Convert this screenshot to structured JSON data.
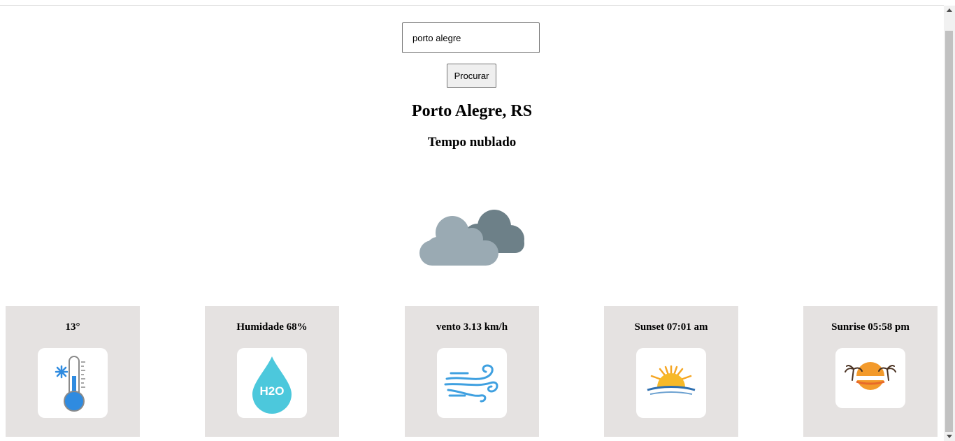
{
  "search": {
    "value": "porto alegre",
    "button_label": "Procurar"
  },
  "location": {
    "city": "Porto Alegre, RS"
  },
  "weather": {
    "condition": "Tempo nublado",
    "icon": "cloud-icon"
  },
  "cards": [
    {
      "label": "13°",
      "icon": "thermometer-icon"
    },
    {
      "label": "Humidade 68%",
      "icon": "water-drop-icon",
      "icon_text": "H2O"
    },
    {
      "label": "vento 3.13 km/h",
      "icon": "wind-icon"
    },
    {
      "label": "Sunset 07:01 am",
      "icon": "sunset-icon"
    },
    {
      "label": "Sunrise 05:58 pm",
      "icon": "sunrise-palm-icon"
    }
  ],
  "colors": {
    "card_bg": "#e5e2e1",
    "cloud_front": "#9aaab3",
    "cloud_back": "#6d8088",
    "water": "#4cc8dc"
  }
}
